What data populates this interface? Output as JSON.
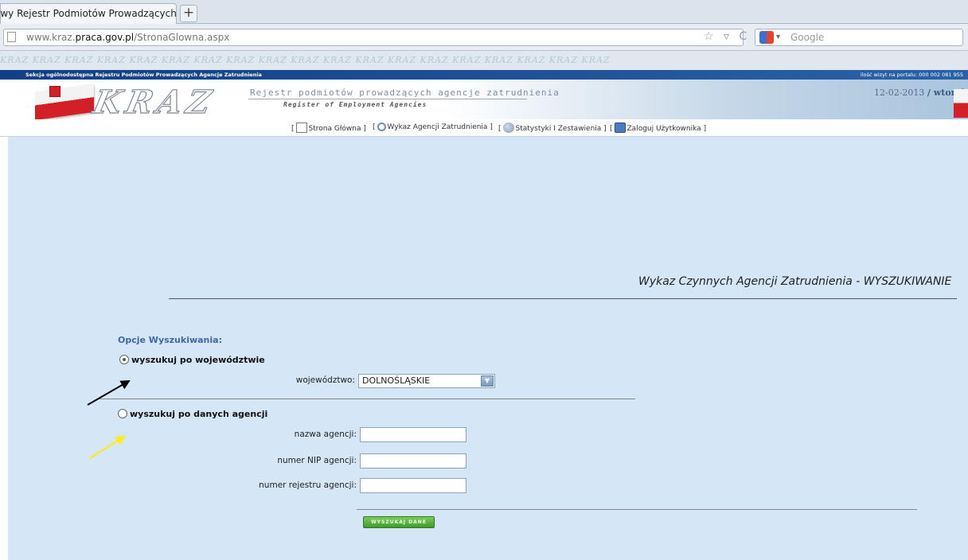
{
  "browser": {
    "tab_title": "owy Rejestr Podmiotów Prowadzących A...",
    "new_tab": "+",
    "url_prefix": "www.kraz.",
    "url_domain": "praca.gov.pl",
    "url_path": "/StronaGlowna.aspx",
    "url_icons": "☆ ▿ C",
    "search_placeholder": "Google",
    "search_caret": "▾"
  },
  "site": {
    "watermark": "KRAZ",
    "section_label": "Sekcja ogólnodostępna Rejestru Podmiotów Prowadzących Agencje Zatrudnienia",
    "visits_label": "ilość wizyt na portalu: 000 002 081 955",
    "logo": "KRAZ",
    "register_pl": "Rejestr podmiotów prowadzących agencje zatrudnienia",
    "register_en": "Register of Employment Agencies",
    "date": "12-02-2013",
    "day": "/ wtorek"
  },
  "menu": {
    "items": [
      {
        "open": "[",
        "label": "Strona Główna",
        "close": "]"
      },
      {
        "open": "[",
        "label": "Wykaz Agencji Zatrudnienia",
        "close": "]"
      },
      {
        "open": "[",
        "label": "Statystyki I Zestawienia",
        "close": "]"
      },
      {
        "open": "[",
        "label": "Zaloguj Użytkownika",
        "close": "]"
      }
    ]
  },
  "main": {
    "title": "Wykaz Czynnych Agencji Zatrudnienia - WYSZUKIWANIE",
    "options_heading": "Opcje Wyszukiwania:",
    "option_voivodeship": {
      "label": "wyszukuj po województwie",
      "checked": true,
      "field_label": "województwo:",
      "selected": "DOLNOŚLĄSKIE",
      "arrow": "▼"
    },
    "option_agency": {
      "label": "wyszukuj po danych agencji",
      "checked": false,
      "fields": [
        {
          "label": "nazwa agencji:",
          "value": ""
        },
        {
          "label": "numer NIP agencji:",
          "value": ""
        },
        {
          "label": "numer rejestru agencji:",
          "value": ""
        }
      ]
    },
    "search_button": "WYSZUKAJ DANE"
  },
  "colors": {
    "content_bg": "#d5e6f7",
    "heading_blue": "#3f67a4",
    "button_green": "#3f9a2a",
    "annotation_black": "#000000",
    "annotation_yellow": "#ffee00"
  }
}
